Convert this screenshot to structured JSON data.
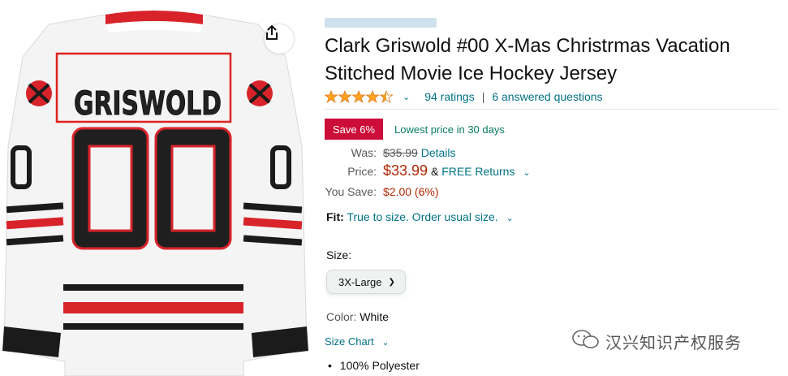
{
  "product": {
    "title": "Clark Griswold #00 X-Mas Christrmas Vacation Stitched Movie Ice Hockey Jersey",
    "jersey_name": "GRISWOLD",
    "jersey_number": "00",
    "rating_stars": 4.5,
    "ratings_count": "94 ratings",
    "separator": "|",
    "answered_questions": "6 answered questions"
  },
  "pricing": {
    "save_badge": "Save 6%",
    "lowest_price_note": "Lowest price in 30 days",
    "was_label": "Was:",
    "was_price": "$35.99",
    "details_link": "Details",
    "price_label": "Price:",
    "price": "$33.99",
    "amp": "&",
    "free_returns": "FREE Returns",
    "you_save_label": "You Save:",
    "you_save_value": "$2.00 (6%)"
  },
  "fit": {
    "label": "Fit:",
    "value": "True to size. Order usual size."
  },
  "size": {
    "label": "Size:",
    "selected": "3X-Large"
  },
  "color": {
    "label": "Color:",
    "value": "White"
  },
  "size_chart": "Size Chart",
  "bullets": [
    "100% Polyester"
  ],
  "watermark": "汉兴知识产权服务",
  "colors": {
    "link": "#007185",
    "price": "#B12704",
    "badge": "#CC0C39",
    "star": "#FFA41C",
    "highlight_box": "#E02020"
  }
}
